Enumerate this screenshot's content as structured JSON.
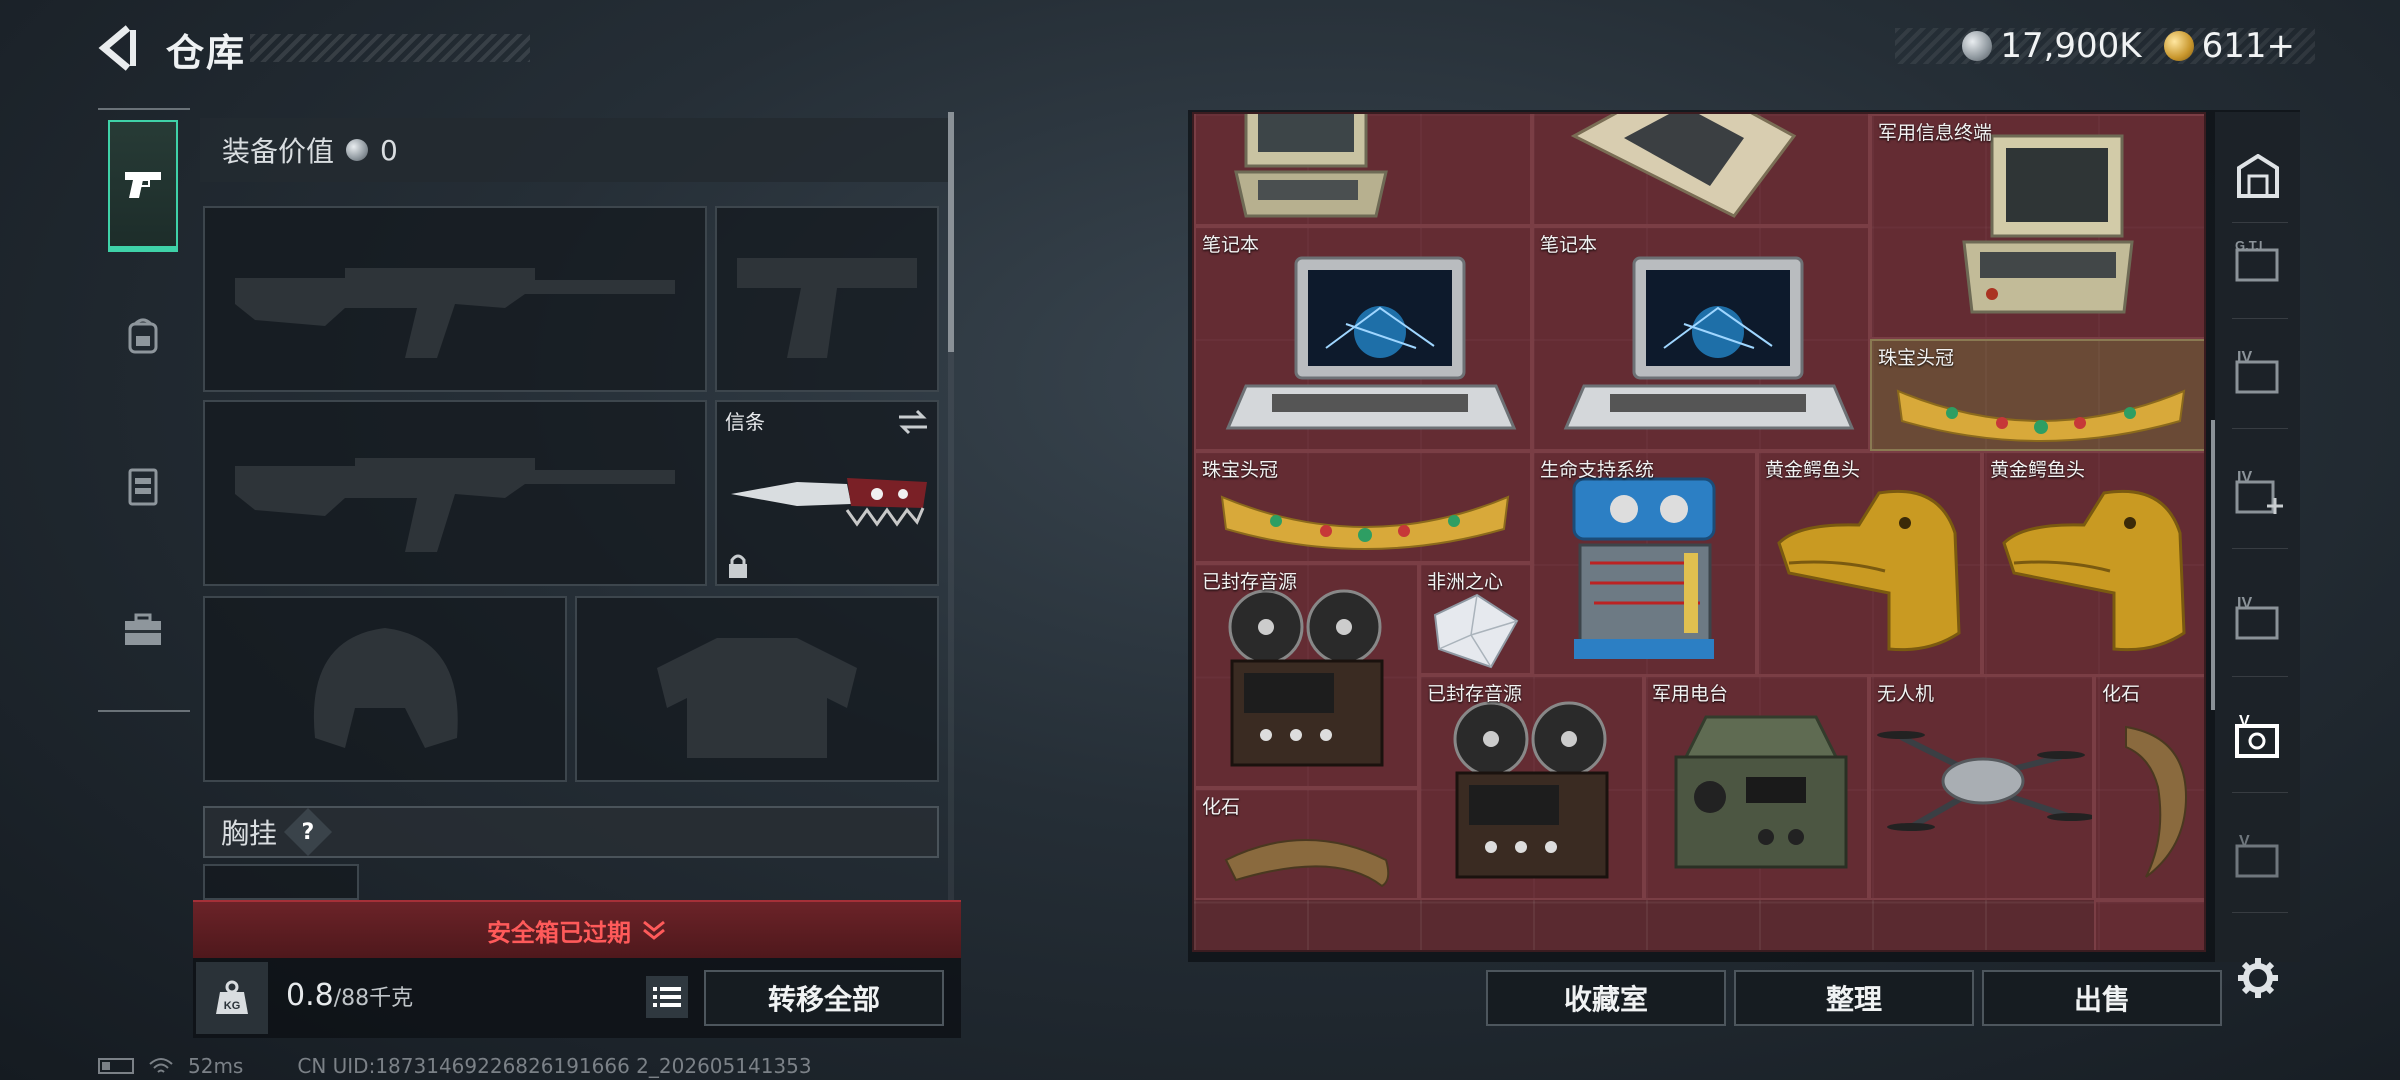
{
  "header": {
    "title": "仓库"
  },
  "currency": {
    "silver": "17,900K",
    "gold": "611+"
  },
  "loadout": {
    "value_label": "装备价值",
    "value": "0",
    "knife_slot_label": "信条",
    "chest_label": "胸挂",
    "chest_badge": "?"
  },
  "safebox": {
    "text": "安全箱已过期"
  },
  "weight": {
    "current": "0.8",
    "max_unit": "/88千克"
  },
  "buttons": {
    "transfer_all": "转移全部",
    "collection": "收藏室",
    "organize": "整理",
    "sell": "出售"
  },
  "stash": {
    "items": [
      {
        "label": ""
      },
      {
        "label": ""
      },
      {
        "label": "军用信息终端"
      },
      {
        "label": "笔记本"
      },
      {
        "label": "笔记本"
      },
      {
        "label": "珠宝头冠"
      },
      {
        "label": "珠宝头冠"
      },
      {
        "label": "生命支持系统"
      },
      {
        "label": "黄金鳄鱼头"
      },
      {
        "label": "黄金鳄鱼头"
      },
      {
        "label": "已封存音源"
      },
      {
        "label": "非洲之心"
      },
      {
        "label": "已封存音源"
      },
      {
        "label": "军用电台"
      },
      {
        "label": "无人机"
      },
      {
        "label": "化石"
      },
      {
        "label": "化石"
      }
    ]
  },
  "status": {
    "ping": "52ms",
    "uid": "CN UID:18731469226826191666 2_202605141353"
  },
  "colors": {
    "accent": "#3fd2a8",
    "danger": "#ff5a5a",
    "grid": "#5a2a30"
  }
}
